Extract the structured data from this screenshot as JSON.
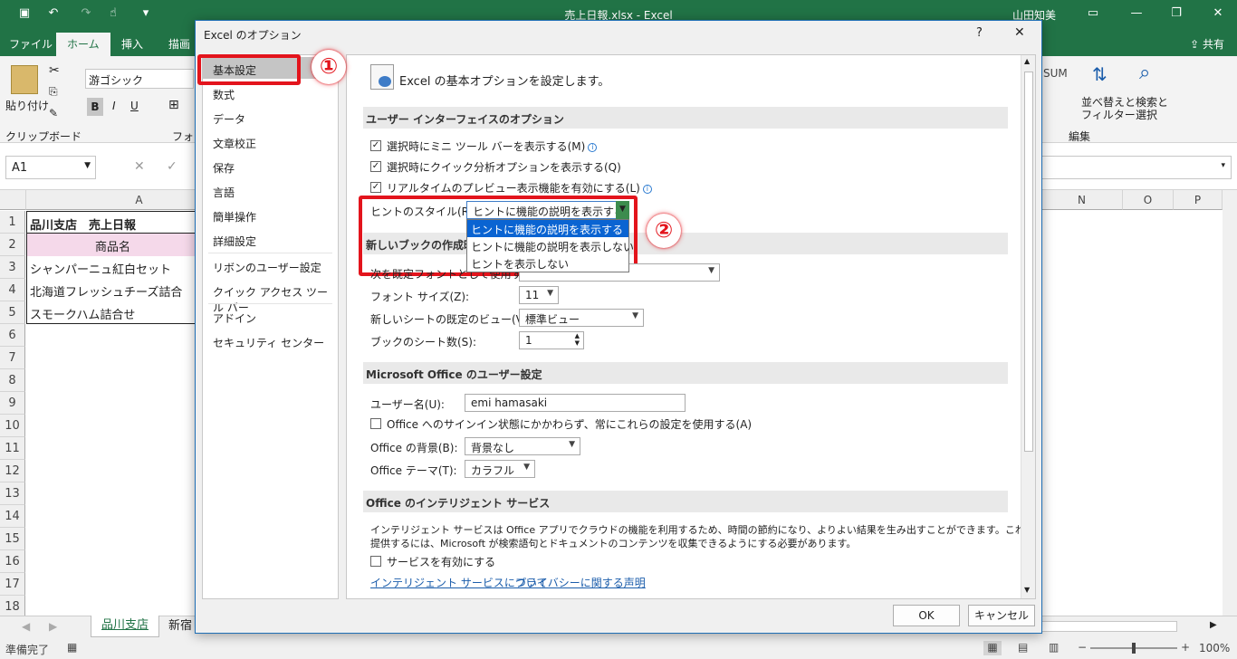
{
  "titlebar": {
    "file_title": "売上日報.xlsx  -  Excel",
    "user": "山田知美",
    "share": "共有"
  },
  "tabs": [
    "ファイル",
    "ホーム",
    "挿入",
    "描画"
  ],
  "ribbon": {
    "paste": "貼り付け",
    "clipboard": "クリップボード",
    "font_group": "フォン",
    "font_name": "游ゴシック",
    "edit_group": "編集",
    "sum": "SUM",
    "sort": "並べ替えと\nフィルター",
    "find": "検索と\n選択"
  },
  "namebox": "A1",
  "columns": {
    "A": "A",
    "N": "N",
    "O": "O",
    "P": "P"
  },
  "rows": [
    "1",
    "2",
    "3",
    "4",
    "5",
    "6",
    "7",
    "8",
    "9",
    "10",
    "11",
    "12",
    "13",
    "14",
    "15",
    "16",
    "17",
    "18"
  ],
  "cells": [
    "品川支店　売上日報",
    "商品名",
    "シャンパーニュ紅白セット",
    "北海道フレッシュチーズ詰合",
    "スモークハム詰合せ"
  ],
  "sheets": [
    "品川支店",
    "新宿"
  ],
  "status": {
    "ready": "準備完了",
    "zoom": "100%"
  },
  "dialog": {
    "title": "Excel のオプション",
    "help": "?",
    "close": "✕",
    "nav": [
      "基本設定",
      "数式",
      "データ",
      "文章校正",
      "保存",
      "言語",
      "簡単操作",
      "詳細設定",
      "リボンのユーザー設定",
      "クイック アクセス ツール バー",
      "アドイン",
      "セキュリティ センター"
    ],
    "header": "Excel の基本オプションを設定します。",
    "sec_ui": "ユーザー インターフェイスのオプション",
    "opt1": "選択時にミニ ツール バーを表示する(M)",
    "opt2": "選択時にクイック分析オプションを表示する(Q)",
    "opt3": "リアルタイムのプレビュー表示機能を有効にする(L)",
    "hint_label": "ヒントのスタイル(R):",
    "hint_value": "ヒントに機能の説明を表示する",
    "hint_options": [
      "ヒントに機能の説明を表示する",
      "ヒントに機能の説明を表示しない",
      "ヒントを表示しない"
    ],
    "sec_newbook": "新しいブックの作成時",
    "font_label": "次を既定フォントとして使用する(N):",
    "font_size_label": "フォント サイズ(Z):",
    "font_size": "11",
    "view_label": "新しいシートの既定のビュー(V):",
    "view_value": "標準ビュー",
    "sheets_label": "ブックのシート数(S):",
    "sheets_value": "1",
    "sec_office": "Microsoft Office のユーザー設定",
    "username_label": "ユーザー名(U):",
    "username": "emi hamasaki",
    "signin_opt": "Office へのサインイン状態にかかわらず、常にこれらの設定を使用する(A)",
    "bg_label": "Office の背景(B):",
    "bg_value": "背景なし",
    "theme_label": "Office テーマ(T):",
    "theme_value": "カラフル",
    "sec_intel": "Office のインテリジェント サービス",
    "intel_text1": "インテリジェント サービスは Office アプリでクラウドの機能を利用するため、時間の節約になり、よりよい結果を生み出すことができます。これらのサービスを",
    "intel_text2": "提供するには、Microsoft が検索語句とドキュメントのコンテンツを収集できるようにする必要があります。",
    "intel_opt": "サービスを有効にする",
    "link1": "インテリジェント サービスについて",
    "link2": "プライバシーに関する声明",
    "ok": "OK",
    "cancel": "キャンセル"
  },
  "callouts": [
    "①",
    "②"
  ]
}
